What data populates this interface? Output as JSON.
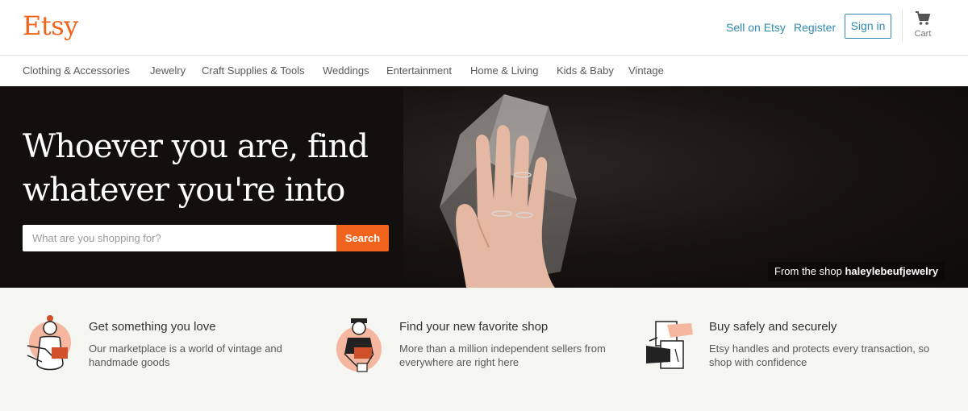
{
  "header": {
    "logo": "Etsy",
    "sell_label": "Sell on Etsy",
    "register_label": "Register",
    "signin_label": "Sign in",
    "cart_label": "Cart",
    "cart_icon": "shopping-cart-icon"
  },
  "nav": {
    "categories": [
      "Clothing & Accessories",
      "Jewelry",
      "Craft Supplies & Tools",
      "Weddings",
      "Entertainment",
      "Home & Living",
      "Kids & Baby",
      "Vintage"
    ]
  },
  "hero": {
    "title": "Whoever you are, find whatever you're into",
    "search_placeholder": "What are you shopping for?",
    "search_button": "Search",
    "credit_prefix": "From the shop",
    "credit_shop": "haleylebeufjewelry"
  },
  "props": [
    {
      "title": "Get something you love",
      "body": "Our marketplace is a world of vintage and handmade goods",
      "icon": "crafter-illustration-icon"
    },
    {
      "title": "Find your new favorite shop",
      "body": "More than a million independent sellers from everywhere are right here",
      "icon": "seller-illustration-icon"
    },
    {
      "title": "Buy safely and securely",
      "body": "Etsy handles and protects every transaction, so shop with confidence",
      "icon": "hands-exchange-illustration-icon"
    }
  ],
  "colors": {
    "brand": "#f1641e",
    "link": "#2f8ab3",
    "hero_bg": "#120f0e",
    "props_bg": "#f5f5f1"
  }
}
